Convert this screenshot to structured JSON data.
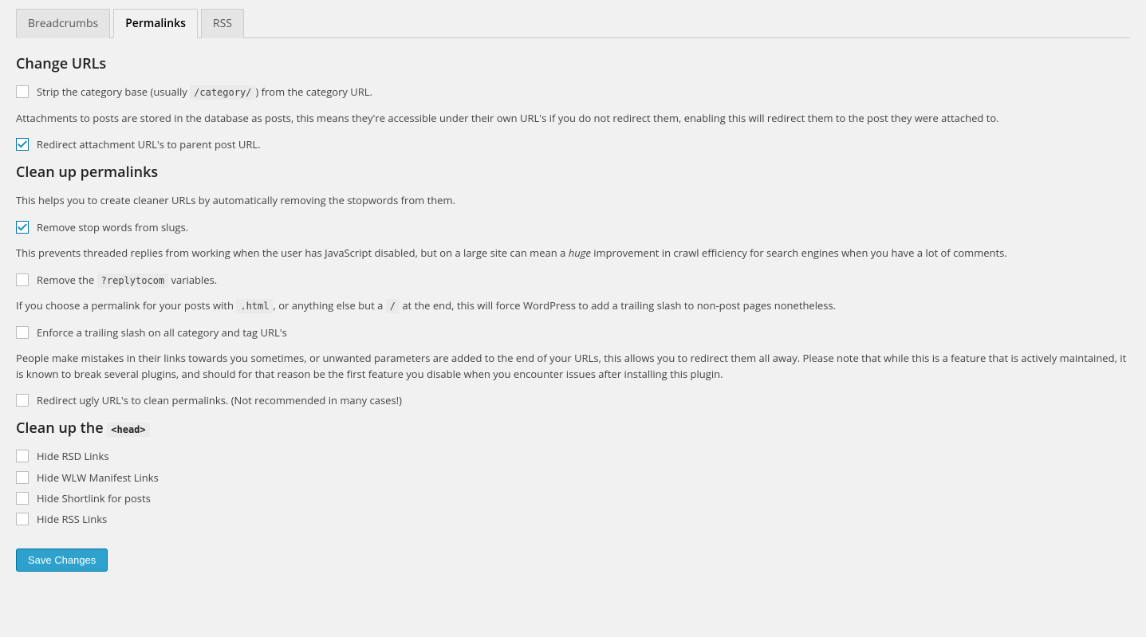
{
  "tabs": {
    "breadcrumbs": "Breadcrumbs",
    "permalinks": "Permalinks",
    "rss": "RSS"
  },
  "sections": {
    "change_urls": {
      "heading": "Change URLs",
      "strip_category": {
        "label_pre": "Strip the category base (usually ",
        "label_code": "/category/",
        "label_post": ") from the category URL.",
        "checked": false
      },
      "redirect_attachment": {
        "description": "Attachments to posts are stored in the database as posts, this means they're accessible under their own URL's if you do not redirect them, enabling this will redirect them to the post they were attached to.",
        "label": "Redirect attachment URL's to parent post URL.",
        "checked": true
      }
    },
    "clean_permalinks": {
      "heading": "Clean up permalinks",
      "stop_words": {
        "description": "This helps you to create cleaner URLs by automatically removing the stopwords from them.",
        "label": "Remove stop words from slugs.",
        "checked": true
      },
      "replytocom": {
        "description_pre": "This prevents threaded replies from working when the user has JavaScript disabled, but on a large site can mean a ",
        "description_em": "huge",
        "description_post": " improvement in crawl efficiency for search engines when you have a lot of comments.",
        "label_pre": "Remove the ",
        "label_code": "?replytocom",
        "label_post": " variables.",
        "checked": false
      },
      "trailing_slash": {
        "description_pre": "If you choose a permalink for your posts with ",
        "description_code1": ".html",
        "description_mid": ", or anything else but a ",
        "description_code2": "/",
        "description_post": " at the end, this will force WordPress to add a trailing slash to non-post pages nonetheless.",
        "label": "Enforce a trailing slash on all category and tag URL's",
        "checked": false
      },
      "redirect_ugly": {
        "description": "People make mistakes in their links towards you sometimes, or unwanted parameters are added to the end of your URLs, this allows you to redirect them all away. Please note that while this is a feature that is actively maintained, it is known to break several plugins, and should for that reason be the first feature you disable when you encounter issues after installing this plugin.",
        "label": "Redirect ugly URL's to clean permalinks. (Not recommended in many cases!)",
        "checked": false
      }
    },
    "clean_head": {
      "heading_pre": "Clean up the ",
      "heading_code": "<head>",
      "hide_rsd": {
        "label": "Hide RSD Links",
        "checked": false
      },
      "hide_wlw": {
        "label": "Hide WLW Manifest Links",
        "checked": false
      },
      "hide_shortlink": {
        "label": "Hide Shortlink for posts",
        "checked": false
      },
      "hide_rss": {
        "label": "Hide RSS Links",
        "checked": false
      }
    }
  },
  "save_button": "Save Changes"
}
